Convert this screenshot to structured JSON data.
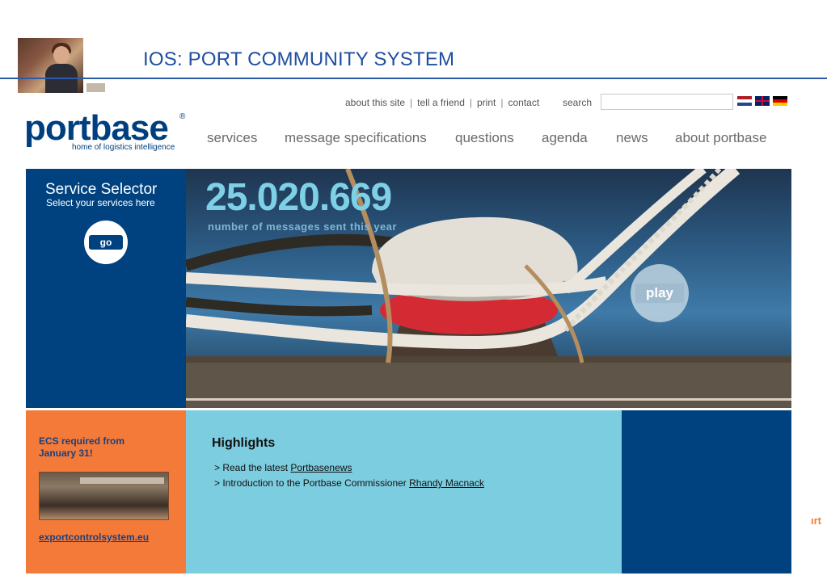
{
  "slide": {
    "title": "IOS: PORT COMMUNITY SYSTEM"
  },
  "toplinks": {
    "items": [
      "about this site",
      "tell a friend",
      "print",
      "contact"
    ],
    "search_label": "search",
    "search_value": ""
  },
  "logo": {
    "name": "portbase",
    "reg": "®",
    "tagline": "home of logistics intelligence"
  },
  "nav": [
    "services",
    "message specifications",
    "questions",
    "agenda",
    "news",
    "about portbase"
  ],
  "selector": {
    "title": "Service Selector",
    "subtitle": "Select your services here",
    "button": "go"
  },
  "hero": {
    "counter": "25.020.669",
    "caption": "number of messages sent this year",
    "play": "play"
  },
  "ecs": {
    "title": "ECS required from January 31!",
    "link": "exportcontrolsystem.eu"
  },
  "highlights": {
    "title": "Highlights",
    "item1_prefix": "> Read the latest ",
    "item1_link": "Portbasenews",
    "item2_prefix": "> Introduction to the Portbase Commissioner ",
    "item2_link": "Rhandy Macnack"
  },
  "edge_text": "ırt",
  "colors": {
    "brand_blue": "#00427f",
    "orange": "#f47a3a",
    "light_blue": "#7dcde0",
    "title_blue": "#1f4fa0"
  }
}
